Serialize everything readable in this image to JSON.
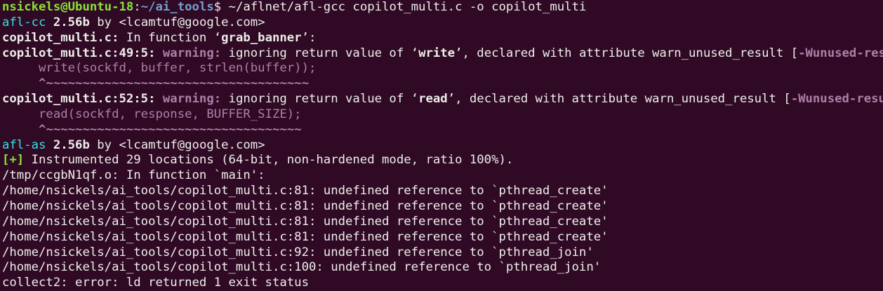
{
  "prompt": {
    "user_host": "nsickels@Ubuntu-18",
    "sep": ":",
    "path": "~/ai_tools",
    "symbol": "$ ",
    "command": "~/aflnet/afl-gcc copilot_multi.c -o copilot_multi"
  },
  "afl_cc": {
    "name": "afl-cc",
    "version": "2.56b",
    "by": " by <lcamtuf@google.com>"
  },
  "compile": {
    "func_file": "copilot_multi.c:",
    "func_text": " In function ‘",
    "func_name": "grab_banner",
    "func_end": "’:",
    "warnings": [
      {
        "loc": "copilot_multi.c:49:5:",
        "label": " warning:",
        "msg1": " ignoring return value of ‘",
        "func": "write",
        "msg2": "’, declared with attribute warn_unused_result [",
        "flag": "-Wunused-result",
        "msg3": "]",
        "code": "     write(sockfd, buffer, strlen(buffer));",
        "caret": "     ^~~~~~~~~~~~~~~~~~~~~~~~~~~~~~~~~~~~~"
      },
      {
        "loc": "copilot_multi.c:52:5:",
        "label": " warning:",
        "msg1": " ignoring return value of ‘",
        "func": "read",
        "msg2": "’, declared with attribute warn_unused_result [",
        "flag": "-Wunused-result",
        "msg3": "]",
        "code": "     read(sockfd, response, BUFFER_SIZE);",
        "caret": "     ^~~~~~~~~~~~~~~~~~~~~~~~~~~~~~~~~~~~"
      }
    ]
  },
  "afl_as": {
    "name": "afl-as",
    "version": "2.56b",
    "by": " by <lcamtuf@google.com>",
    "plus": "[+]",
    "instrumented": " Instrumented 29 locations (64-bit, non-hardened mode, ratio 100%)."
  },
  "linker": {
    "lines": [
      "/tmp/ccgbN1qf.o: In function `main':",
      "/home/nsickels/ai_tools/copilot_multi.c:81: undefined reference to `pthread_create'",
      "/home/nsickels/ai_tools/copilot_multi.c:81: undefined reference to `pthread_create'",
      "/home/nsickels/ai_tools/copilot_multi.c:81: undefined reference to `pthread_create'",
      "/home/nsickels/ai_tools/copilot_multi.c:81: undefined reference to `pthread_create'",
      "/home/nsickels/ai_tools/copilot_multi.c:92: undefined reference to `pthread_join'",
      "/home/nsickels/ai_tools/copilot_multi.c:100: undefined reference to `pthread_join'",
      "collect2: error: ld returned 1 exit status"
    ]
  },
  "colors": {
    "background": "#300a24",
    "text": "#eeeeec",
    "prompt_user": "#8ae234",
    "prompt_path": "#729fcf",
    "afl_name": "#34e2e2",
    "warning": "#ad7fa8",
    "plus": "#8ae234"
  }
}
